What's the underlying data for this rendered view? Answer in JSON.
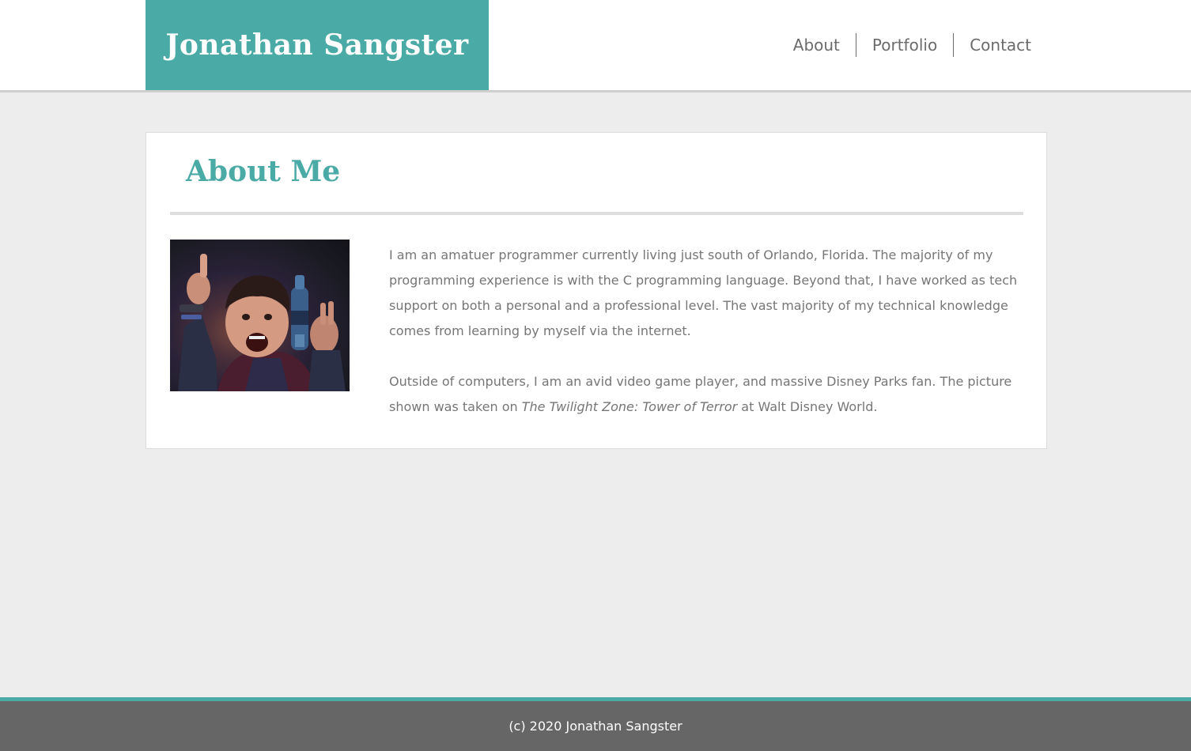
{
  "header": {
    "site_title": "Jonathan Sangster",
    "nav": [
      {
        "label": "About"
      },
      {
        "label": "Portfolio"
      },
      {
        "label": "Contact"
      }
    ]
  },
  "main": {
    "heading": "About Me",
    "bio_paragraph_1": "I am an amatuer programmer currently living just south of Orlando, Florida. The majority of my programming experience is with the C programming language. Beyond that, I have worked as tech support on both a personal and a professional level. The vast majority of my technical knowledge comes from learning by myself via the internet.",
    "bio_paragraph_2_before": "Outside of computers, I am an avid video game player, and massive Disney Parks fan. The picture shown was taken on ",
    "bio_paragraph_2_italic": "The Twilight Zone: Tower of Terror",
    "bio_paragraph_2_after": " at Walt Disney World."
  },
  "footer": {
    "copyright": "(c) 2020 Jonathan Sangster"
  },
  "colors": {
    "accent": "#4aaaa5",
    "text": "#767676",
    "footer_bg": "#666666",
    "page_bg": "#ededed"
  }
}
